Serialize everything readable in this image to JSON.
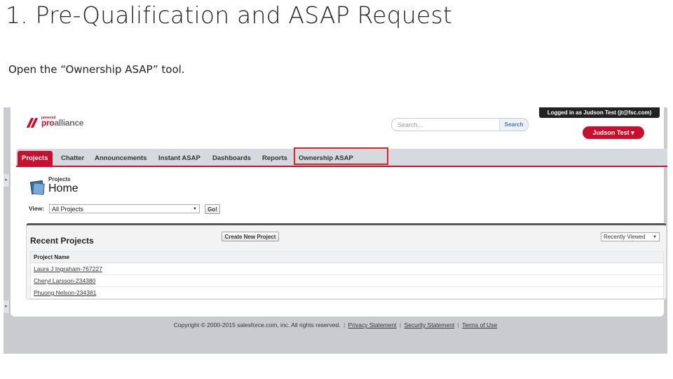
{
  "slide": {
    "title": "1. Pre-Qualification and ASAP Request",
    "subtitle": "Open the “Ownership ASAP” tool."
  },
  "brand": {
    "logo_sup": "powered",
    "logo_pro": "pro",
    "logo_alliance": "alliance",
    "accent_color": "#c8102e"
  },
  "header": {
    "search_placeholder": "Search...",
    "search_button": "Search",
    "login_status": "Logged in as Judson Test (jt@fsc.com)",
    "user_menu": "Judson Test ▾"
  },
  "tabs": [
    {
      "label": "Projects",
      "active": true
    },
    {
      "label": "Chatter",
      "active": false
    },
    {
      "label": "Announcements",
      "active": false
    },
    {
      "label": "Instant ASAP",
      "active": false
    },
    {
      "label": "Dashboards",
      "active": false
    },
    {
      "label": "Reports",
      "active": false
    },
    {
      "label": "Ownership ASAP",
      "active": false,
      "highlighted": true
    }
  ],
  "page": {
    "subtitle": "Projects",
    "title": "Home",
    "icon": "projects-icon"
  },
  "view": {
    "label": "View:",
    "selected": "All Projects",
    "go_button": "Go!"
  },
  "recent": {
    "title": "Recent Projects",
    "create_button": "Create New Project",
    "sort_selected": "Recently Viewed",
    "column_header": "Project Name",
    "rows": [
      "Laura J Ingraham-767227",
      "Cheryl Larsson-234380",
      "Phuong Nelson-234381"
    ]
  },
  "footer": {
    "copyright": "Copyright © 2000-2015 salesforce.com, inc. All rights reserved.",
    "links": [
      "Privacy Statement",
      "Security Statement",
      "Terms of Use"
    ]
  }
}
